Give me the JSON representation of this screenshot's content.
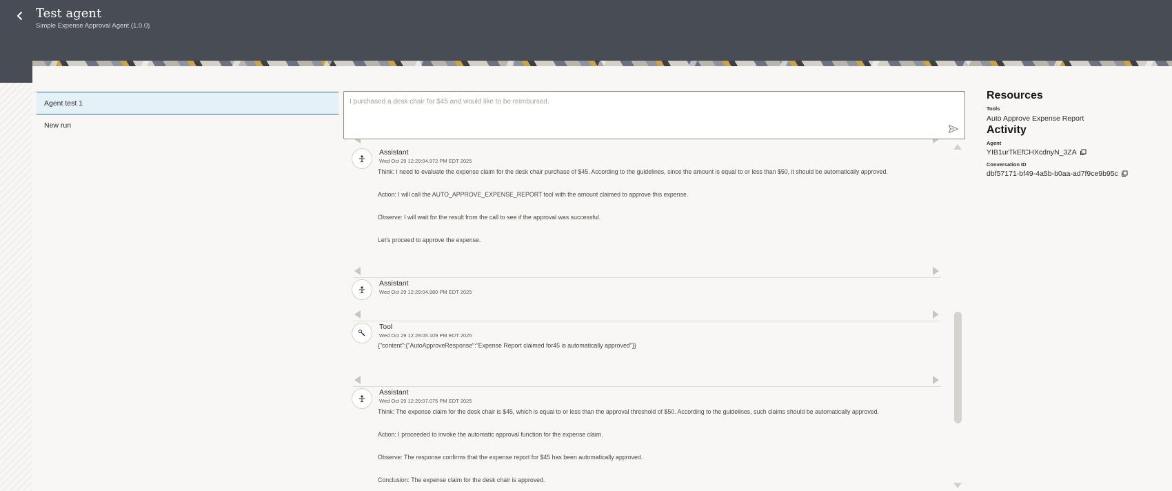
{
  "header": {
    "title": "Test agent",
    "subtitle": "Simple Expense Approval Agent (1.0.0)"
  },
  "sidebar": {
    "items": [
      {
        "label": "Agent test 1"
      },
      {
        "label": "New run"
      }
    ]
  },
  "input": {
    "placeholder": "I purchased a desk chair for $45 and would like to be reimbursed."
  },
  "messages": [
    {
      "role": "Assistant",
      "time": "Wed Oct 29 12:29:04.972 PM EDT 2025",
      "lines": [
        "Think: I need to evaluate the expense claim for the desk chair purchase of $45. According to the guidelines, since the amount is equal to or less than $50, it should be automatically approved.",
        "Action: I will call the AUTO_APPROVE_EXPENSE_REPORT tool with the amount claimed to approve this expense.",
        "Observe: I will wait for the result from the call to see if the approval was successful.",
        "Let's proceed to approve the expense."
      ]
    },
    {
      "role": "Assistant",
      "time": "Wed Oct 29 12:29:04.980 PM EDT 2025",
      "lines": []
    },
    {
      "role": "Tool",
      "time": "Wed Oct 29 12:29:05.109 PM EDT 2025",
      "lines": [
        "{\"content\":{\"AutoApproveResponse\":\"Expense Report claimed for45 is automatically approved\"}}"
      ]
    },
    {
      "role": "Assistant",
      "time": "Wed Oct 29 12:29:07.075 PM EDT 2025",
      "lines": [
        "Think: The expense claim for the desk chair is $45, which is equal to or less than the approval threshold of $50. According to the guidelines, such claims should be automatically approved.",
        "Action: I proceeded to invoke the automatic approval function for the expense claim.",
        "Observe: The response confirms that the expense report for $45 has been automatically approved.",
        "Conclusion: The expense claim for the desk chair is approved."
      ]
    }
  ],
  "resources": {
    "heading": "Resources",
    "tools_label": "Tools",
    "tool_name": "Auto Approve Expense Report"
  },
  "activity": {
    "heading": "Activity",
    "agent_label": "Agent",
    "agent_id": "YIB1urTkEfCHXcdnyN_3ZA",
    "conversation_label": "Conversation ID",
    "conversation_id": "dbf57171-bf49-4a5b-b0aa-ad7f9ce9b95c"
  },
  "colors": {
    "header_bg": "#474c55",
    "active_item_bg": "#e4f1f7",
    "active_item_border": "#2b6a8a",
    "page_bg": "#f8f7f5"
  }
}
